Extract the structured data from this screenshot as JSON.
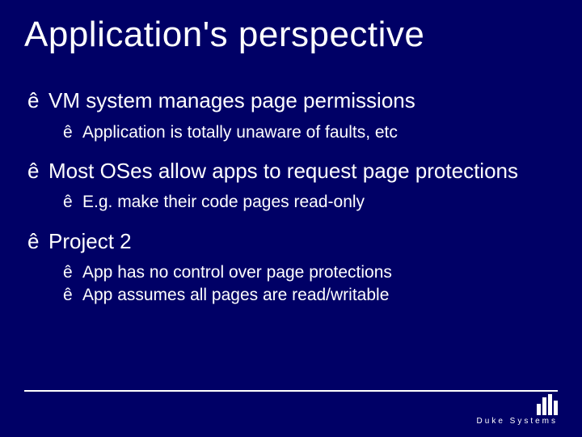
{
  "title": "Application's perspective",
  "bullets": {
    "b1": "VM system manages page permissions",
    "b1a": "Application is totally unaware of faults, etc",
    "b2": "Most OSes allow apps to request page protections",
    "b2a": "E.g. make their code pages read-only",
    "b3": "Project 2",
    "b3a": "App has no control over page protections",
    "b3b": "App assumes all pages are read/writable"
  },
  "bullet_glyph": "ê",
  "logo_text": "Duke Systems"
}
